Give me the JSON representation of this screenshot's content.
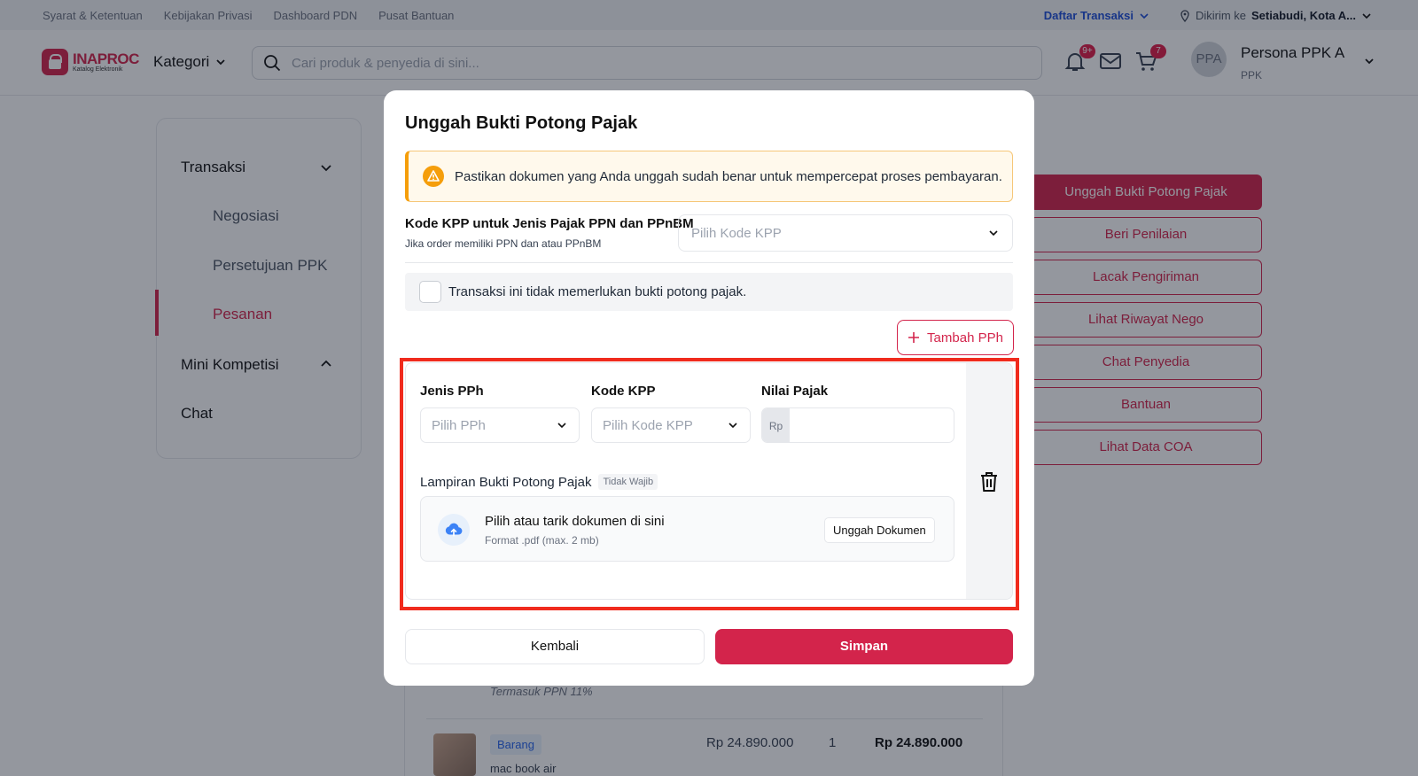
{
  "topbar": {
    "links": [
      "Syarat & Ketentuan",
      "Kebijakan Privasi",
      "Dashboard PDN",
      "Pusat Bantuan"
    ],
    "transactions_label": "Daftar Transaksi",
    "deliver_prefix": "Dikirim ke",
    "deliver_location": "Setiabudi, Kota A..."
  },
  "header": {
    "logo_main": "INAPROC",
    "logo_sub": "Katalog Elektronik",
    "kategori": "Kategori",
    "search_placeholder": "Cari produk & penyedia di sini...",
    "notif_badge": "9+",
    "cart_badge": "7",
    "avatar_initials": "PPA",
    "user_name": "Persona PPK A",
    "user_role": "PPK"
  },
  "sidebar": {
    "transaksi": "Transaksi",
    "negosiasi": "Negosiasi",
    "persetujuan": "Persetujuan PPK",
    "pesanan": "Pesanan",
    "mini_kompetisi": "Mini Kompetisi",
    "chat": "Chat"
  },
  "actions": [
    "Unggah Bukti Potong Pajak",
    "Beri Penilaian",
    "Lacak Pengiriman",
    "Lihat Riwayat Nego",
    "Chat Penyedia",
    "Bantuan",
    "Lihat Data COA"
  ],
  "background_order": {
    "tax_note": "Termasuk PPN 11%",
    "tag": "Barang",
    "product_name": "mac book air",
    "price": "Rp 24.890.000",
    "qty": "1",
    "total": "Rp 24.890.000"
  },
  "modal": {
    "title": "Unggah Bukti Potong Pajak",
    "alert_text": "Pastikan dokumen yang Anda unggah sudah benar untuk mempercepat proses pembayaran.",
    "kpp_label": "Kode KPP untuk Jenis Pajak PPN dan PPnBM",
    "kpp_sublabel": "Jika order memiliki PPN dan atau PPnBM",
    "kpp_placeholder": "Pilih Kode KPP",
    "checkbox_label": "Transaksi ini tidak memerlukan bukti potong pajak.",
    "add_pph": "Tambah PPh",
    "pph": {
      "jenis_label": "Jenis PPh",
      "jenis_placeholder": "Pilih PPh",
      "kode_label": "Kode KPP",
      "kode_placeholder": "Pilih Kode KPP",
      "nilai_label": "Nilai Pajak",
      "currency": "Rp",
      "lampiran_label": "Lampiran Bukti Potong Pajak",
      "lampiran_tag": "Tidak Wajib",
      "drop_title": "Pilih atau tarik dokumen di sini",
      "drop_format": "Format .pdf (max. 2 mb)",
      "upload_button": "Unggah Dokumen"
    },
    "back_button": "Kembali",
    "save_button": "Simpan"
  },
  "colors": {
    "brand": "#d3244b",
    "highlight": "#f02b1d",
    "link": "#1d4ed8"
  }
}
